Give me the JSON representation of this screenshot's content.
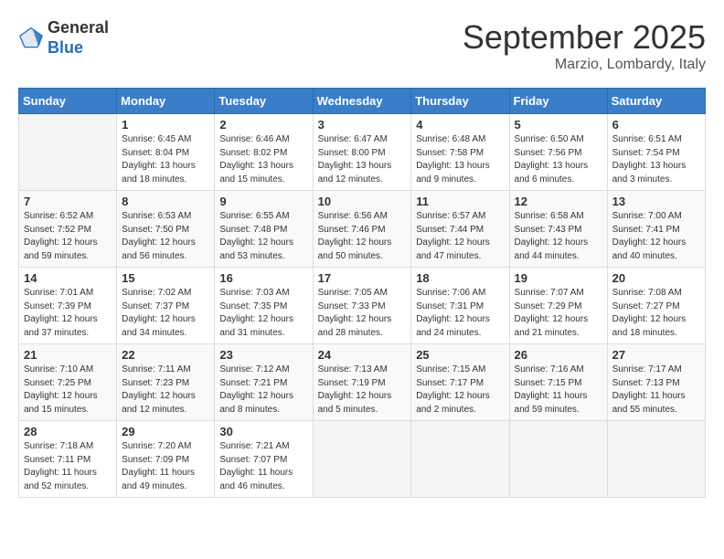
{
  "header": {
    "logo_line1": "General",
    "logo_line2": "Blue",
    "month": "September 2025",
    "location": "Marzio, Lombardy, Italy"
  },
  "days_of_week": [
    "Sunday",
    "Monday",
    "Tuesday",
    "Wednesday",
    "Thursday",
    "Friday",
    "Saturday"
  ],
  "weeks": [
    [
      {
        "day": "",
        "info": ""
      },
      {
        "day": "1",
        "info": "Sunrise: 6:45 AM\nSunset: 8:04 PM\nDaylight: 13 hours\nand 18 minutes."
      },
      {
        "day": "2",
        "info": "Sunrise: 6:46 AM\nSunset: 8:02 PM\nDaylight: 13 hours\nand 15 minutes."
      },
      {
        "day": "3",
        "info": "Sunrise: 6:47 AM\nSunset: 8:00 PM\nDaylight: 13 hours\nand 12 minutes."
      },
      {
        "day": "4",
        "info": "Sunrise: 6:48 AM\nSunset: 7:58 PM\nDaylight: 13 hours\nand 9 minutes."
      },
      {
        "day": "5",
        "info": "Sunrise: 6:50 AM\nSunset: 7:56 PM\nDaylight: 13 hours\nand 6 minutes."
      },
      {
        "day": "6",
        "info": "Sunrise: 6:51 AM\nSunset: 7:54 PM\nDaylight: 13 hours\nand 3 minutes."
      }
    ],
    [
      {
        "day": "7",
        "info": "Sunrise: 6:52 AM\nSunset: 7:52 PM\nDaylight: 12 hours\nand 59 minutes."
      },
      {
        "day": "8",
        "info": "Sunrise: 6:53 AM\nSunset: 7:50 PM\nDaylight: 12 hours\nand 56 minutes."
      },
      {
        "day": "9",
        "info": "Sunrise: 6:55 AM\nSunset: 7:48 PM\nDaylight: 12 hours\nand 53 minutes."
      },
      {
        "day": "10",
        "info": "Sunrise: 6:56 AM\nSunset: 7:46 PM\nDaylight: 12 hours\nand 50 minutes."
      },
      {
        "day": "11",
        "info": "Sunrise: 6:57 AM\nSunset: 7:44 PM\nDaylight: 12 hours\nand 47 minutes."
      },
      {
        "day": "12",
        "info": "Sunrise: 6:58 AM\nSunset: 7:43 PM\nDaylight: 12 hours\nand 44 minutes."
      },
      {
        "day": "13",
        "info": "Sunrise: 7:00 AM\nSunset: 7:41 PM\nDaylight: 12 hours\nand 40 minutes."
      }
    ],
    [
      {
        "day": "14",
        "info": "Sunrise: 7:01 AM\nSunset: 7:39 PM\nDaylight: 12 hours\nand 37 minutes."
      },
      {
        "day": "15",
        "info": "Sunrise: 7:02 AM\nSunset: 7:37 PM\nDaylight: 12 hours\nand 34 minutes."
      },
      {
        "day": "16",
        "info": "Sunrise: 7:03 AM\nSunset: 7:35 PM\nDaylight: 12 hours\nand 31 minutes."
      },
      {
        "day": "17",
        "info": "Sunrise: 7:05 AM\nSunset: 7:33 PM\nDaylight: 12 hours\nand 28 minutes."
      },
      {
        "day": "18",
        "info": "Sunrise: 7:06 AM\nSunset: 7:31 PM\nDaylight: 12 hours\nand 24 minutes."
      },
      {
        "day": "19",
        "info": "Sunrise: 7:07 AM\nSunset: 7:29 PM\nDaylight: 12 hours\nand 21 minutes."
      },
      {
        "day": "20",
        "info": "Sunrise: 7:08 AM\nSunset: 7:27 PM\nDaylight: 12 hours\nand 18 minutes."
      }
    ],
    [
      {
        "day": "21",
        "info": "Sunrise: 7:10 AM\nSunset: 7:25 PM\nDaylight: 12 hours\nand 15 minutes."
      },
      {
        "day": "22",
        "info": "Sunrise: 7:11 AM\nSunset: 7:23 PM\nDaylight: 12 hours\nand 12 minutes."
      },
      {
        "day": "23",
        "info": "Sunrise: 7:12 AM\nSunset: 7:21 PM\nDaylight: 12 hours\nand 8 minutes."
      },
      {
        "day": "24",
        "info": "Sunrise: 7:13 AM\nSunset: 7:19 PM\nDaylight: 12 hours\nand 5 minutes."
      },
      {
        "day": "25",
        "info": "Sunrise: 7:15 AM\nSunset: 7:17 PM\nDaylight: 12 hours\nand 2 minutes."
      },
      {
        "day": "26",
        "info": "Sunrise: 7:16 AM\nSunset: 7:15 PM\nDaylight: 11 hours\nand 59 minutes."
      },
      {
        "day": "27",
        "info": "Sunrise: 7:17 AM\nSunset: 7:13 PM\nDaylight: 11 hours\nand 55 minutes."
      }
    ],
    [
      {
        "day": "28",
        "info": "Sunrise: 7:18 AM\nSunset: 7:11 PM\nDaylight: 11 hours\nand 52 minutes."
      },
      {
        "day": "29",
        "info": "Sunrise: 7:20 AM\nSunset: 7:09 PM\nDaylight: 11 hours\nand 49 minutes."
      },
      {
        "day": "30",
        "info": "Sunrise: 7:21 AM\nSunset: 7:07 PM\nDaylight: 11 hours\nand 46 minutes."
      },
      {
        "day": "",
        "info": ""
      },
      {
        "day": "",
        "info": ""
      },
      {
        "day": "",
        "info": ""
      },
      {
        "day": "",
        "info": ""
      }
    ]
  ]
}
